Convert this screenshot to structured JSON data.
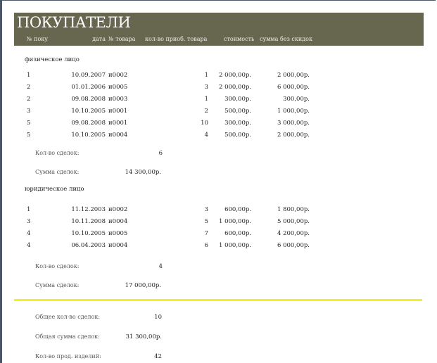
{
  "title": "ПОКУПАТЕЛИ",
  "columns": {
    "buyer": "№ поку",
    "date": "дата",
    "item": "№ товара",
    "qty": "кол-во приоб. товара",
    "cost": "стоимость",
    "sum": "сумма без скидок"
  },
  "groups": [
    {
      "name": "физическое лицо",
      "rows": [
        {
          "buyer": "1",
          "date": "10.09.2007",
          "item": "и0002",
          "qty": "1",
          "cost": "2 000,00р.",
          "sum": "2 000,00р."
        },
        {
          "buyer": "2",
          "date": "01.01.2006",
          "item": "и0005",
          "qty": "3",
          "cost": "2 000,00р.",
          "sum": "6 000,00р."
        },
        {
          "buyer": "2",
          "date": "09.08.2008",
          "item": "и0003",
          "qty": "1",
          "cost": "300,00р.",
          "sum": "300,00р."
        },
        {
          "buyer": "3",
          "date": "10.10.2005",
          "item": "и0001",
          "qty": "2",
          "cost": "500,00р.",
          "sum": "1 000,00р."
        },
        {
          "buyer": "5",
          "date": "09.08.2008",
          "item": "и0001",
          "qty": "10",
          "cost": "300,00р.",
          "sum": "3 000,00р."
        },
        {
          "buyer": "5",
          "date": "10.10.2005",
          "item": "и0004",
          "qty": "4",
          "cost": "500,00р.",
          "sum": "2 000,00р."
        }
      ],
      "count_label": "Кол-во сделок:",
      "count": "6",
      "sum_label": "Сумма сделок:",
      "sum": "14 300,00р."
    },
    {
      "name": "юридическое лицо",
      "rows": [
        {
          "buyer": "1",
          "date": "11.12.2003",
          "item": "и0002",
          "qty": "3",
          "cost": "600,00р.",
          "sum": "1 800,00р."
        },
        {
          "buyer": "3",
          "date": "10.11.2008",
          "item": "и0004",
          "qty": "5",
          "cost": "1 000,00р.",
          "sum": "5 000,00р."
        },
        {
          "buyer": "4",
          "date": "10.10.2005",
          "item": "и0005",
          "qty": "7",
          "cost": "600,00р.",
          "sum": "4 200,00р."
        },
        {
          "buyer": "4",
          "date": "06.04.2003",
          "item": "и0004",
          "qty": "6",
          "cost": "1 000,00р.",
          "sum": "6 000,00р."
        }
      ],
      "count_label": "Кол-во сделок:",
      "count": "4",
      "sum_label": "Сумма сделок:",
      "sum": "17 000,00р."
    }
  ],
  "totals": [
    {
      "label": "Общее кол-во сделок:",
      "value": "10"
    },
    {
      "label": "Общая сумма сделок:",
      "value": "31 300,00р."
    },
    {
      "label": "Кол-во прод. изделий:",
      "value": "42"
    }
  ],
  "colors": {
    "header": "#676750",
    "separator": "#f5ee20"
  }
}
